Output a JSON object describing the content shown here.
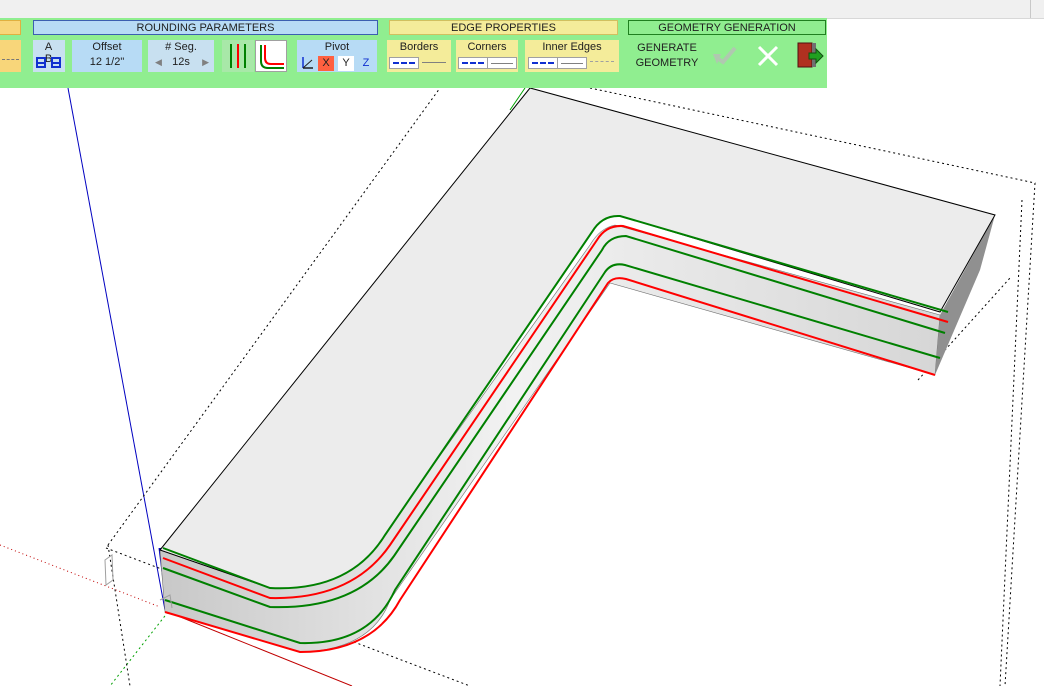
{
  "toolbar": {
    "headers": {
      "rounding": "ROUNDING PARAMETERS",
      "edge": "EDGE PROPERTIES",
      "geometry": "GEOMETRY GENERATION"
    },
    "ab_label": "A B",
    "offset": {
      "label": "Offset",
      "value": "12 1/2\""
    },
    "segments": {
      "label": "# Seg.",
      "value": "12s"
    },
    "pivot": {
      "label": "Pivot",
      "x": "X",
      "y": "Y",
      "z": "Z"
    },
    "edge": {
      "borders": "Borders",
      "corners": "Corners",
      "inner_edges": "Inner Edges"
    },
    "generate": {
      "line1": "GENERATE",
      "line2": "GEOMETRY"
    }
  },
  "colors": {
    "toolbar_bg": "#90ee90",
    "rounding_header": "#b7dbf5",
    "edge_header": "#f4ec9a",
    "pivot_x_active": "#ff6040",
    "border_red": "#ff0000",
    "border_green": "#008000",
    "axis_blue": "#0000c0"
  }
}
